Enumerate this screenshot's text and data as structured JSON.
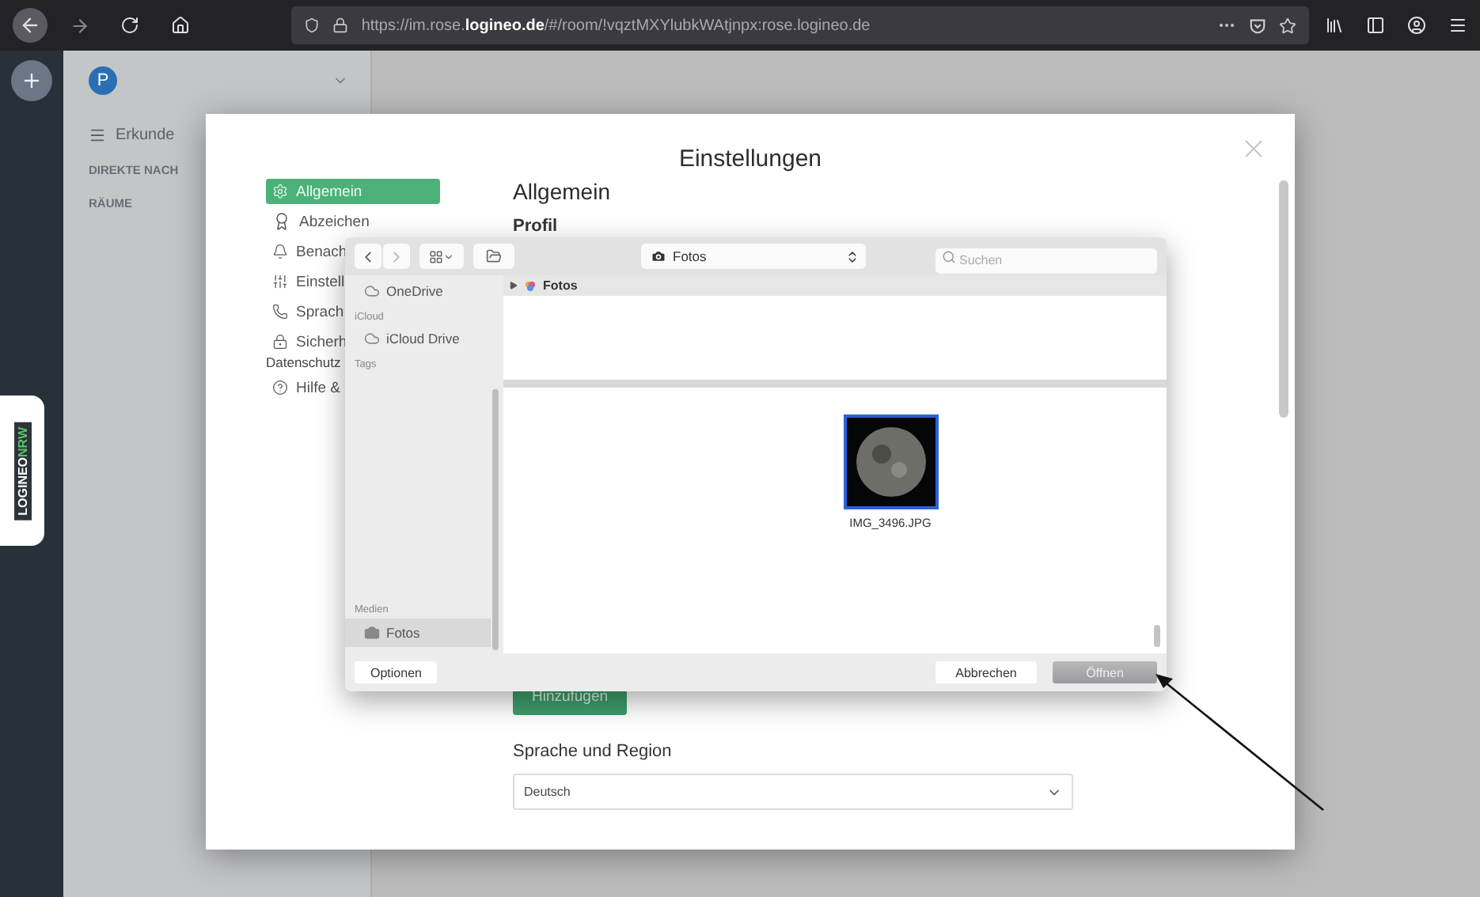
{
  "browser": {
    "url": "https://im.rose.**logineo.de**/#/room/!vqztMXYlubkWAtjnpx:rose.logineo.de"
  },
  "app": {
    "avatar": "P",
    "explore": "Erkunde",
    "sections": [
      "DIREKTE NACH",
      "RÄUME"
    ],
    "logo": {
      "brand": "LOGINEO",
      "region": "NRW"
    }
  },
  "settings": {
    "title": "Einstellungen",
    "nav": [
      {
        "label": "Allgemein",
        "selected": true
      },
      {
        "label": "Abzeichen",
        "selected": false
      },
      {
        "label": "Benach",
        "selected": false
      },
      {
        "label": "Einstell",
        "selected": false
      },
      {
        "label": "Sprach",
        "selected": false
      },
      {
        "label": "Sicherh",
        "continuation": "Datenschutz",
        "selected": false
      },
      {
        "label": "Hilfe &",
        "selected": false
      }
    ],
    "heading": "Allgemein",
    "subheading": "Profil",
    "add_button": "Hinzufügen",
    "language_heading": "Sprache und Region",
    "language_select": "Deutsch"
  },
  "file_dialog": {
    "location": "Fotos",
    "search_placeholder": "Suchen",
    "sidebar_top": [
      {
        "kind": "cloud",
        "label": "OneDrive",
        "selected": false
      },
      {
        "kind": "header",
        "label": "iCloud"
      },
      {
        "kind": "cloud",
        "label": "iCloud Drive",
        "selected": false
      },
      {
        "kind": "header",
        "label": "Tags"
      }
    ],
    "sidebar_bottom": [
      {
        "kind": "header",
        "label": "Medien"
      },
      {
        "kind": "media",
        "label": "Fotos",
        "selected": true
      }
    ],
    "folder_row": "Fotos",
    "files": [
      {
        "name": "IMG_3496.JPG",
        "selected": true
      }
    ],
    "options_button": "Optionen",
    "cancel_button": "Abbrechen",
    "open_button": "Öffnen"
  }
}
